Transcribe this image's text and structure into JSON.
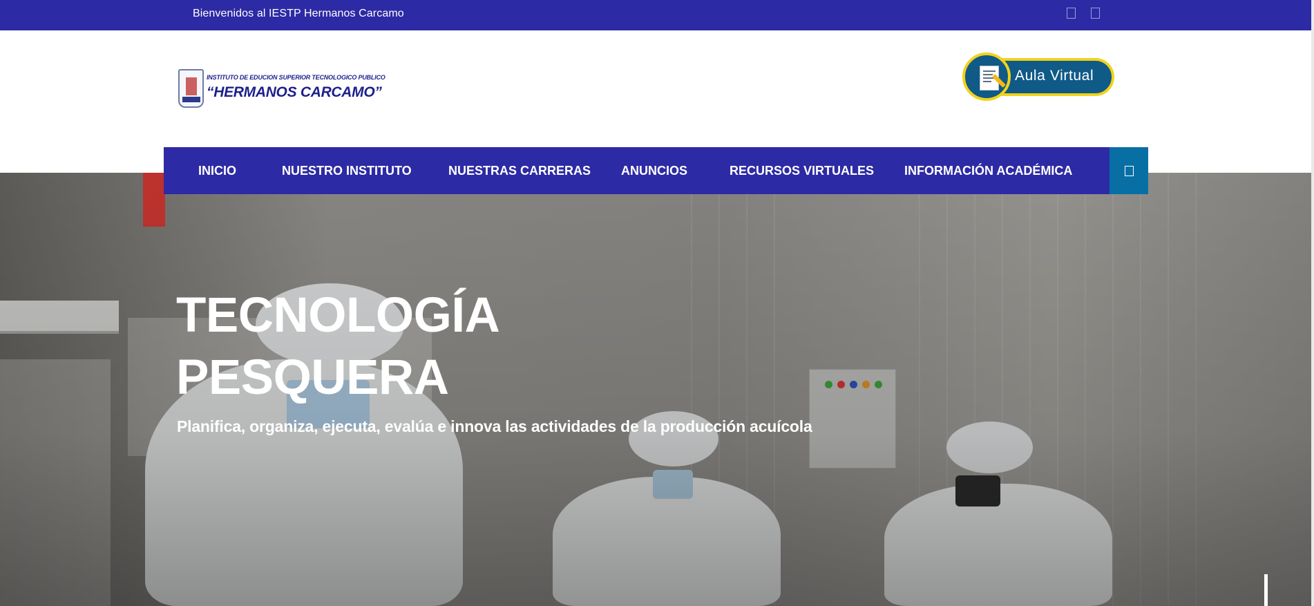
{
  "topbar": {
    "welcome_text": "Bienvenidos al IESTP Hermanos Carcamo",
    "social_icons": [
      "facebook-icon",
      "youtube-icon"
    ]
  },
  "header": {
    "logo_line1": "INSTITUTO DE EDUCION SUPERIOR TECNOLOGICO PUBLICO",
    "logo_line2": "“HERMANOS CARCAMO”",
    "aula_virtual_label": "Aula Virtual"
  },
  "nav": {
    "items": [
      {
        "label": "INICIO"
      },
      {
        "label": "NUESTRO INSTITUTO"
      },
      {
        "label": "NUESTRAS CARRERAS"
      },
      {
        "label": "ANUNCIOS"
      },
      {
        "label": "RECURSOS VIRTUALES"
      },
      {
        "label": "INFORMACIÓN ACADÉMICA"
      }
    ],
    "search_icon": "search-icon"
  },
  "hero": {
    "title_line1": "TECNOLOGÍA",
    "title_line2": "PESQUERA",
    "subtitle": "Planifica, organiza, ejecuta, evalúa e innova las actividades de la producción acuícola"
  },
  "colors": {
    "brand_blue": "#2d2aa5",
    "search_blue": "#086fa5",
    "accent_yellow": "#f1d21c"
  }
}
